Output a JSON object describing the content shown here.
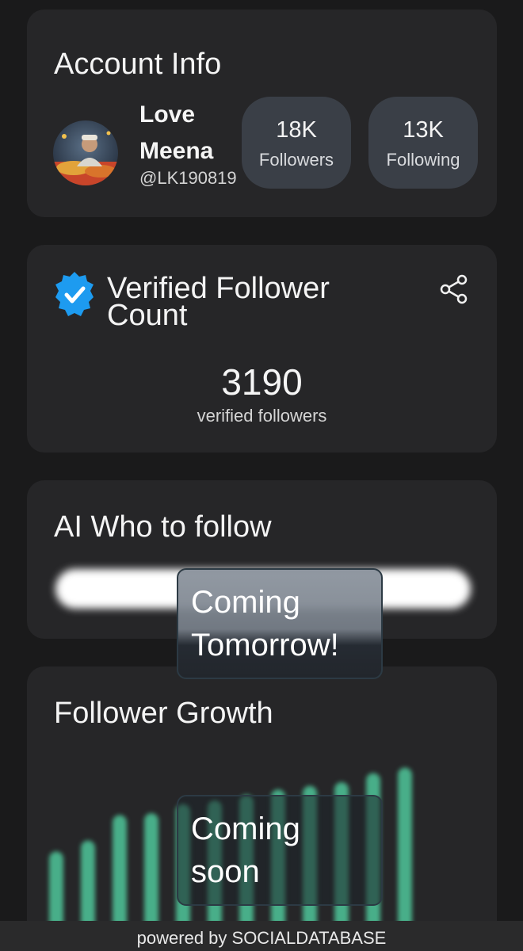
{
  "account": {
    "title": "Account Info",
    "name": "Love Meena",
    "handle": "@LK190819",
    "followers": {
      "value": "18K",
      "label": "Followers"
    },
    "following": {
      "value": "13K",
      "label": "Following"
    }
  },
  "verified": {
    "title": "Verified Follower Count",
    "count": "3190",
    "count_label": "verified followers",
    "badge_color": "#1d9bf0"
  },
  "ai_follow": {
    "title": "AI Who to follow",
    "overlay_text": "Coming Tomorrow!"
  },
  "growth": {
    "title": "Follower Growth",
    "overlay_text": "Coming soon",
    "bar_color": "#4fc79a",
    "bar_levels": [
      0.42,
      0.48,
      0.62,
      0.63,
      0.68,
      0.7,
      0.73,
      0.76,
      0.78,
      0.8,
      0.85,
      0.88
    ]
  },
  "footer": {
    "text": "powered by SOCIALDATABASE"
  }
}
